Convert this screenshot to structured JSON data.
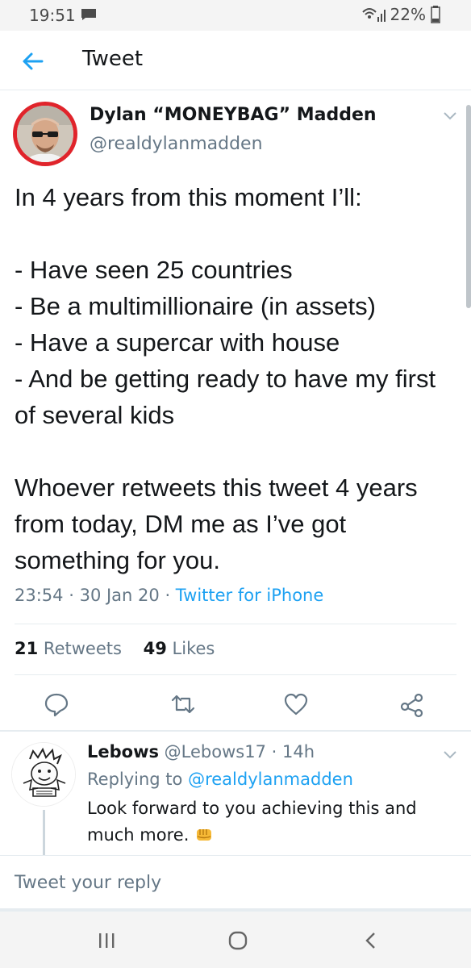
{
  "status_bar": {
    "time": "19:51",
    "battery": "22%"
  },
  "app_bar": {
    "title": "Tweet"
  },
  "tweet": {
    "author_name": "Dylan “MONEYBAG” Madden",
    "author_handle": "@realdylanmadden",
    "text": "In 4 years from this moment I’ll:\n\n- Have seen 25 countries\n- Be a multimillionaire (in assets)\n- Have a supercar with house\n- And be getting ready to have my first  of several kids\n\nWhoever retweets this tweet 4 years from today, DM me as I’ve got something for you.",
    "time": "23:54",
    "date": "30 Jan 20",
    "source": "Twitter for iPhone",
    "retweets_count": "21",
    "retweets_label": "Retweets",
    "likes_count": "49",
    "likes_label": "Likes"
  },
  "reply": {
    "name": "Lebows",
    "handle": "@Lebows17",
    "age": "14h",
    "replying_label": "Replying to",
    "replying_to": "@realdylanmadden",
    "text": "Look forward to you achieving this and much more."
  },
  "compose": {
    "placeholder": "Tweet your reply"
  },
  "colors": {
    "accent": "#1da1f2",
    "muted": "#657786",
    "text": "#14171a"
  },
  "icons": [
    "back-arrow-icon",
    "reply-icon",
    "retweet-icon",
    "like-icon",
    "share-icon",
    "chevron-down-icon",
    "fist-emoji-icon",
    "recent-apps-icon",
    "home-icon",
    "back-icon"
  ]
}
